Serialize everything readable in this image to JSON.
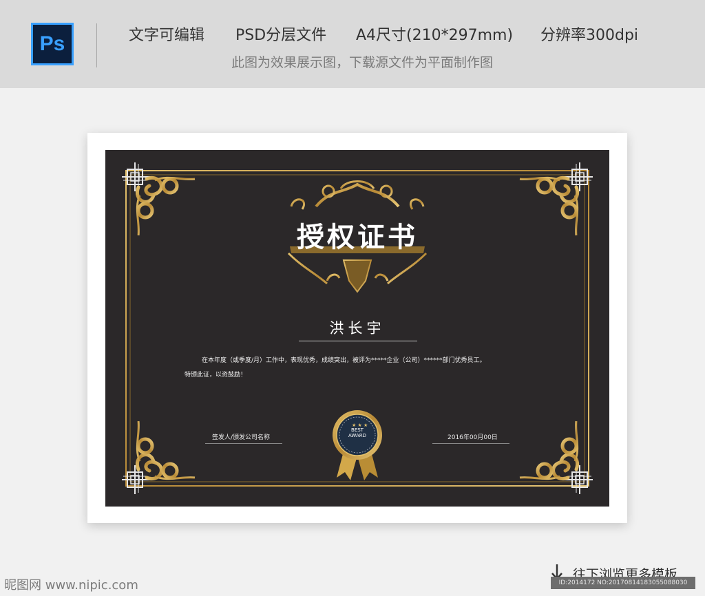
{
  "header": {
    "logo_text": "Ps",
    "features": [
      "文字可编辑",
      "PSD分层文件",
      "A4尺寸(210*297mm)",
      "分辨率300dpi"
    ],
    "note": "此图为效果展示图，下载源文件为平面制作图"
  },
  "certificate": {
    "title": "授权证书",
    "name": "洪长宇",
    "body_line1": "在本年度（或季度/月）工作中，表现优秀，成绩突出，被评为*****企业（公司）******部门优秀员工。",
    "body_line2": "特颁此证，以资鼓励！",
    "signature_label": "签发人/颁发公司名称",
    "date_label": "2016年00月00日",
    "badge": {
      "line1": "BEST",
      "line2": "AWARD"
    }
  },
  "footer": {
    "more_link": "往下浏览更多模板",
    "watermark": "昵图网 www.nipic.com",
    "id_text": "ID:2014172 NO:20170814183055088030"
  },
  "colors": {
    "cert_bg": "#2b2829",
    "gold": "#c9a04a",
    "header_bg": "#dadada",
    "ps_blue": "#39a0ff"
  }
}
